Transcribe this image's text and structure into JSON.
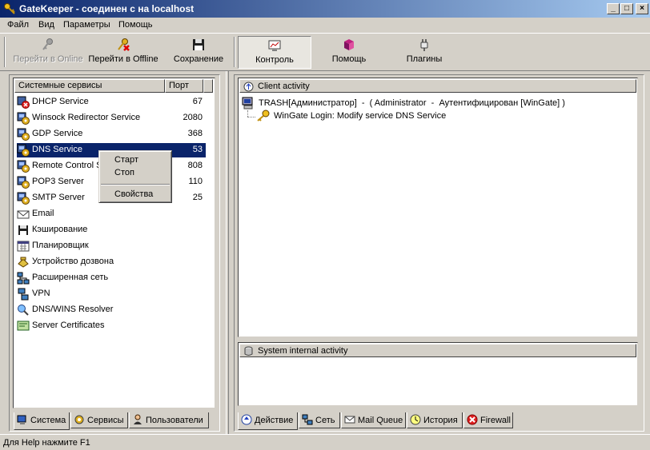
{
  "window": {
    "title": "GateKeeper - соединен с на localhost",
    "minimize": "_",
    "maximize": "□",
    "close": "×"
  },
  "menu": [
    {
      "label": "Файл"
    },
    {
      "label": "Вид"
    },
    {
      "label": "Параметры"
    },
    {
      "label": "Помощь"
    }
  ],
  "toolbar": {
    "go_online": "Перейти в Online",
    "go_offline": "Перейти в Offline",
    "save": "Сохранение",
    "control": "Контроль",
    "help": "Помощь",
    "plugins": "Плагины"
  },
  "services_panel": {
    "col_name": "Системные сервисы",
    "col_port": "Порт",
    "items": [
      {
        "name": "DHCP Service",
        "port": "67",
        "icon": "service-stopped-icon"
      },
      {
        "name": "Winsock Redirector Service",
        "port": "2080",
        "icon": "service-gear-icon"
      },
      {
        "name": "GDP Service",
        "port": "368",
        "icon": "service-gear-icon"
      },
      {
        "name": "DNS Service",
        "port": "53",
        "icon": "service-gear-icon"
      },
      {
        "name": "Remote Control S",
        "port": "808",
        "icon": "service-gear-icon"
      },
      {
        "name": "POP3 Server",
        "port": "110",
        "icon": "service-gear-icon"
      },
      {
        "name": "SMTP Server",
        "port": "25",
        "icon": "service-gear-icon"
      },
      {
        "name": "Email",
        "port": "",
        "icon": "envelope-icon"
      },
      {
        "name": "Кэширование",
        "port": "",
        "icon": "floppy-icon"
      },
      {
        "name": "Планировщик",
        "port": "",
        "icon": "calendar-icon"
      },
      {
        "name": "Устройство дозвона",
        "port": "",
        "icon": "phone-icon"
      },
      {
        "name": "Расширенная сеть",
        "port": "",
        "icon": "network-icon"
      },
      {
        "name": "VPN",
        "port": "",
        "icon": "vpn-icon"
      },
      {
        "name": "DNS/WINS Resolver",
        "port": "",
        "icon": "resolver-icon"
      },
      {
        "name": "Server Certificates",
        "port": "",
        "icon": "certificate-icon"
      }
    ],
    "selected_index": 3
  },
  "context_menu": {
    "start": "Старт",
    "stop": "Стоп",
    "properties": "Свойства"
  },
  "left_tabs": [
    {
      "label": "Система",
      "icon": "system-icon"
    },
    {
      "label": "Сервисы",
      "icon": "services-icon"
    },
    {
      "label": "Пользователи",
      "icon": "users-icon"
    }
  ],
  "client_activity": {
    "header": "Client activity",
    "session": "TRASH[Администратор]  -  ( Administrator  -  Аутентифицирован [WinGate] )",
    "event": "WinGate Login: Modify service DNS Service"
  },
  "system_activity": {
    "header": "System internal activity"
  },
  "right_tabs": [
    {
      "label": "Действие",
      "icon": "action-icon"
    },
    {
      "label": "Сеть",
      "icon": "network-icon"
    },
    {
      "label": "Mail Queue",
      "icon": "mail-icon"
    },
    {
      "label": "История",
      "icon": "clock-icon"
    },
    {
      "label": "Firewall",
      "icon": "firewall-icon"
    }
  ],
  "status": "Для Help нажмите F1",
  "colors": {
    "title_start": "#0a246a",
    "title_end": "#a6caf0",
    "face": "#d4d0c8",
    "selection": "#0a246a"
  }
}
